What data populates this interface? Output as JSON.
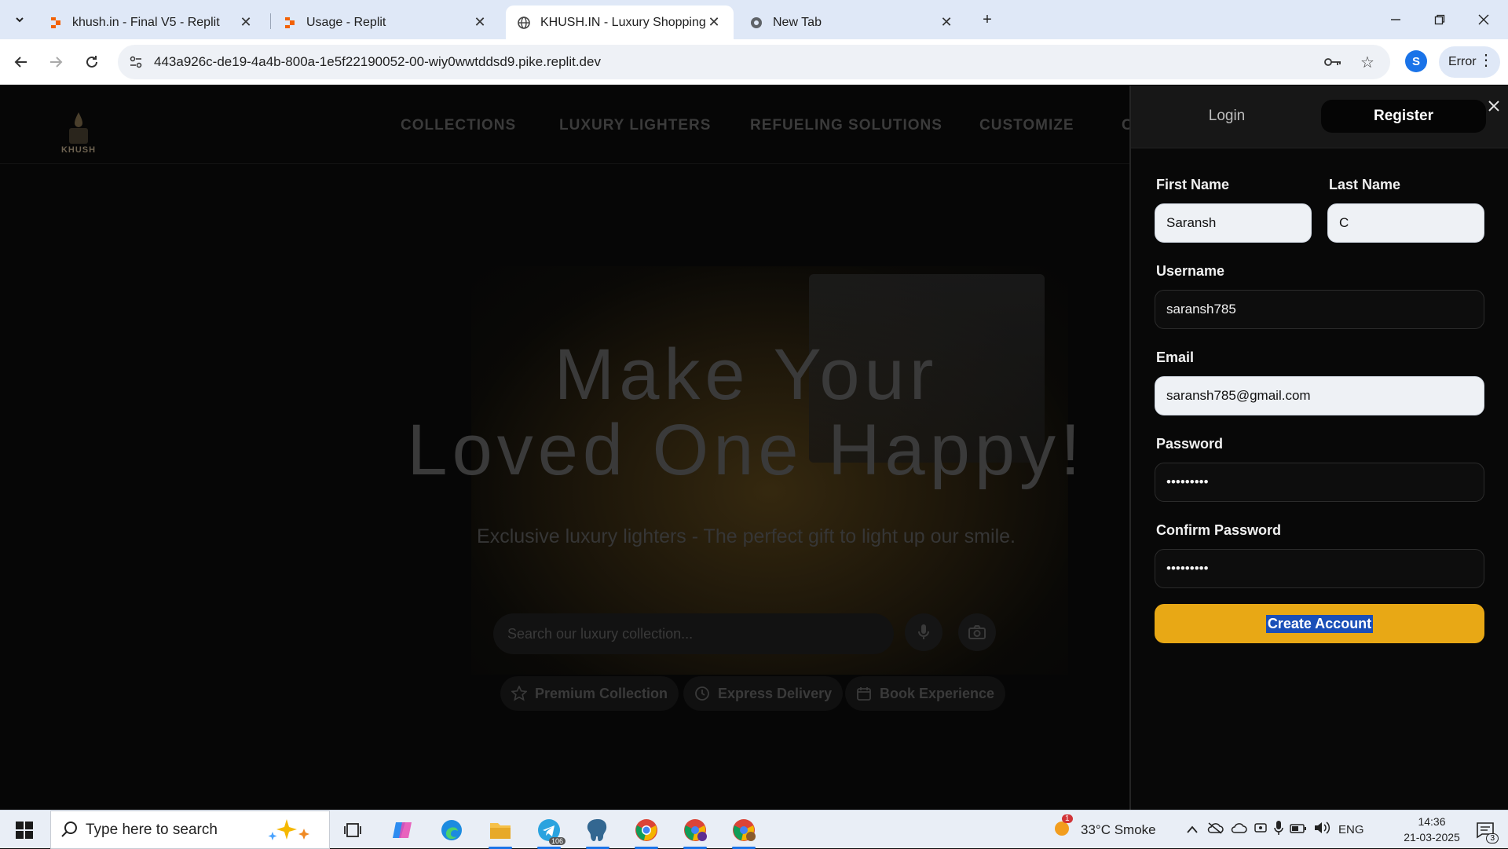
{
  "browser": {
    "tabs": [
      {
        "title": "khush.in - Final V5 - Replit",
        "favicon": "replit-icon"
      },
      {
        "title": "Usage - Replit",
        "favicon": "replit-icon"
      },
      {
        "title": "KHUSH.IN - Luxury Shopping E",
        "favicon": "globe-icon",
        "active": true
      },
      {
        "title": "New Tab",
        "favicon": "chrome-icon"
      }
    ],
    "url": "443a926c-de19-4a4b-800a-1e5f22190052-00-wiy0wwtddsd9.pike.replit.dev",
    "profile_initial": "S",
    "error_label": "Error"
  },
  "site": {
    "logo_text": "KHUSH",
    "nav": [
      "COLLECTIONS",
      "LUXURY LIGHTERS",
      "REFUELING SOLUTIONS",
      "CUSTOMIZE",
      "C"
    ],
    "headline_line1": "Make Your",
    "headline_line2": "Loved One Happy!",
    "subline": "Exclusive luxury lighters - The perfect gift to light up our smile.",
    "search_placeholder": "Search our luxury collection...",
    "pills": [
      "Premium Collection",
      "Express Delivery",
      "Book Experience"
    ]
  },
  "auth_panel": {
    "tab_login": "Login",
    "tab_register": "Register",
    "first_name_label": "First Name",
    "first_name_value": "Saransh",
    "last_name_label": "Last Name",
    "last_name_value": "C",
    "username_label": "Username",
    "username_value": "saransh785",
    "email_label": "Email",
    "email_value": "saransh785@gmail.com",
    "password_label": "Password",
    "password_value": "•••••••••",
    "confirm_label": "Confirm Password",
    "confirm_value": "•••••••••",
    "submit_label": "Create Account"
  },
  "taskbar": {
    "search_text": "Type here to search",
    "weather": "33°C  Smoke",
    "weather_badge": "1",
    "language": "ENG",
    "time": "14:36",
    "date": "21-03-2025",
    "notification_count": "3",
    "telegram_badge": "106"
  },
  "colors": {
    "accent_button": "#e8a815",
    "selection": "#1a4fb8",
    "panel_bg": "#080808"
  }
}
